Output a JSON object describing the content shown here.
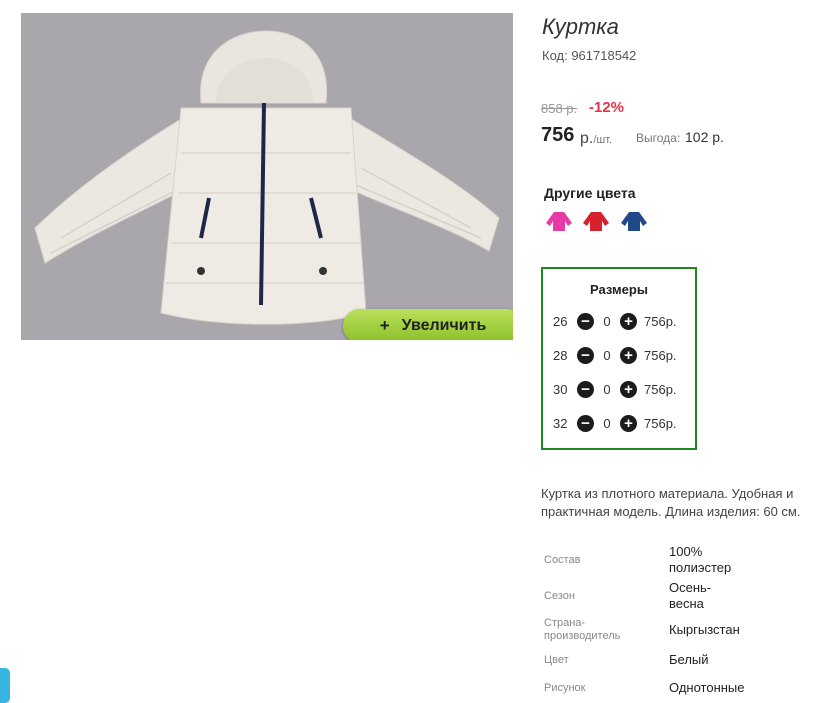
{
  "product": {
    "title": "Куртка",
    "code": "Код: 961718542",
    "image_bg": "#a9a6ac",
    "zoom_label": "Увеличить"
  },
  "pricing": {
    "old_price": "858 р.",
    "discount": "-12%",
    "price": "756",
    "currency": "р.",
    "unit": "/шт.",
    "benefit_label": "Выгода:",
    "benefit_value": "102 р."
  },
  "colors": {
    "title": "Другие цвета",
    "swatches": [
      {
        "name": "pink",
        "color": "#e83aa7"
      },
      {
        "name": "red",
        "color": "#d9202e"
      },
      {
        "name": "blue",
        "color": "#21498a"
      }
    ]
  },
  "sizes": {
    "title": "Размеры",
    "rows": [
      {
        "size": "26",
        "qty": "0",
        "price": "756р."
      },
      {
        "size": "28",
        "qty": "0",
        "price": "756р."
      },
      {
        "size": "30",
        "qty": "0",
        "price": "756р."
      },
      {
        "size": "32",
        "qty": "0",
        "price": "756р."
      }
    ]
  },
  "description": "Куртка из плотного материала. Удобная и практичная модель. Длина изделия: 60 см.",
  "specs": [
    {
      "label": "Состав",
      "value": "100% полиэстер"
    },
    {
      "label": "Сезон",
      "value": "Осень-весна"
    },
    {
      "label": "Страна-производитель",
      "value": "Кыргызстан"
    },
    {
      "label": "Цвет",
      "value": "Белый"
    },
    {
      "label": "Рисунок",
      "value": "Однотонные"
    }
  ],
  "accent": {
    "box_border": "#1e8a1e",
    "discount": "#e8304a",
    "zoom_button": "#a5d443"
  }
}
